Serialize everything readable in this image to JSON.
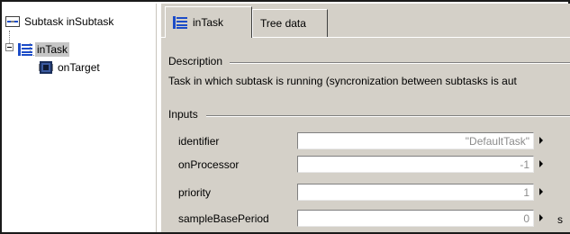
{
  "tree": {
    "root": {
      "label": "Subtask inSubtask",
      "icon": "subtask-icon"
    },
    "child": {
      "label": "inTask",
      "icon": "task-icon",
      "selected": true
    },
    "grandchild": {
      "label": "onTarget",
      "icon": "target-icon"
    }
  },
  "tabs": [
    {
      "label": "inTask",
      "icon": "task-icon",
      "active": true
    },
    {
      "label": "Tree data",
      "active": false
    }
  ],
  "description": {
    "title": "Description",
    "text": "Task in which subtask is running (syncronization between subtasks is aut"
  },
  "inputs": {
    "title": "Inputs",
    "fields": [
      {
        "label": "identifier",
        "value": "\"DefaultTask\"",
        "unit": ""
      },
      {
        "label": "onProcessor",
        "value": "-1",
        "unit": ""
      },
      {
        "label": "priority",
        "value": "1",
        "unit": ""
      },
      {
        "label": "sampleBasePeriod",
        "value": "0",
        "unit": "s"
      }
    ]
  },
  "colors": {
    "panel": "#d4d0c8",
    "selection": "#c6c6c6",
    "task_icon_blue": "#1c4cc8"
  }
}
